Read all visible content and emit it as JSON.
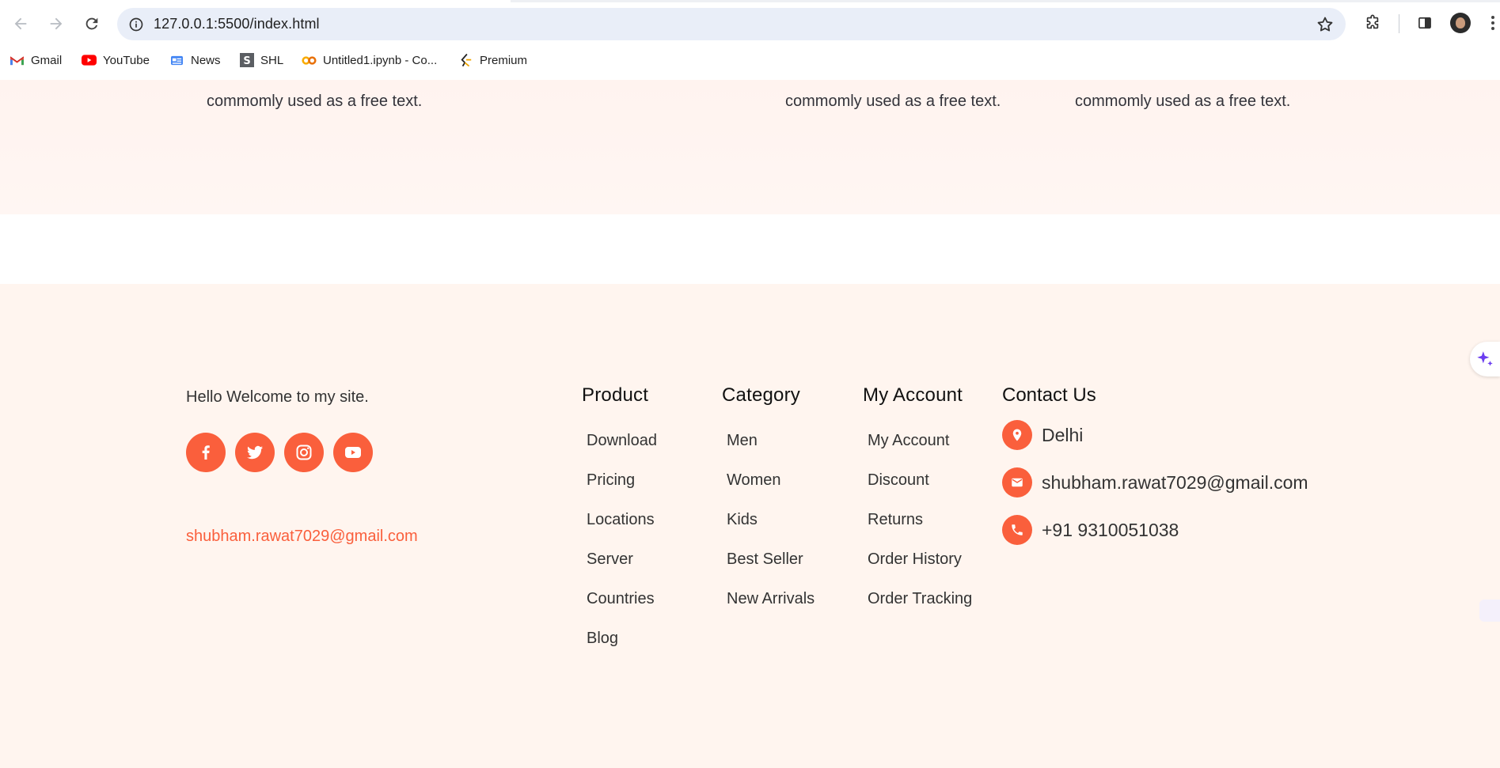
{
  "browser": {
    "url": "127.0.0.1:5500/index.html",
    "bookmarks": [
      {
        "label": "Gmail",
        "icon": "gmail-icon"
      },
      {
        "label": "YouTube",
        "icon": "youtube-icon"
      },
      {
        "label": "News",
        "icon": "news-icon"
      },
      {
        "label": "SHL",
        "icon": "shl-icon"
      },
      {
        "label": "Untitled1.ipynb - Co...",
        "icon": "colab-icon"
      },
      {
        "label": "Premium",
        "icon": "premium-icon"
      }
    ]
  },
  "features": {
    "texts": [
      "commomly used as a free text.",
      "commomly used as a free text.",
      "commomly used as a free text."
    ]
  },
  "footer": {
    "welcome": "Hello Welcome to my site.",
    "socials": [
      "facebook-icon",
      "twitter-icon",
      "instagram-icon",
      "youtube-icon"
    ],
    "email": "shubham.rawat7029@gmail.com",
    "columns": [
      {
        "title": "Product",
        "items": [
          "Download",
          "Pricing",
          "Locations",
          "Server",
          "Countries",
          "Blog"
        ]
      },
      {
        "title": "Category",
        "items": [
          "Men",
          "Women",
          "Kids",
          "Best Seller",
          "New Arrivals"
        ]
      },
      {
        "title": "My Account",
        "items": [
          "My Account",
          "Discount",
          "Returns",
          "Order History",
          "Order Tracking"
        ]
      }
    ],
    "contact": {
      "title": "Contact Us",
      "location": "Delhi",
      "email": "shubham.rawat7029@gmail.com",
      "phone": "+91 9310051038"
    }
  },
  "colors": {
    "accent": "#fa5f3c",
    "footer_bg": "#fff5ef",
    "band_bg": "#fff3ef"
  }
}
